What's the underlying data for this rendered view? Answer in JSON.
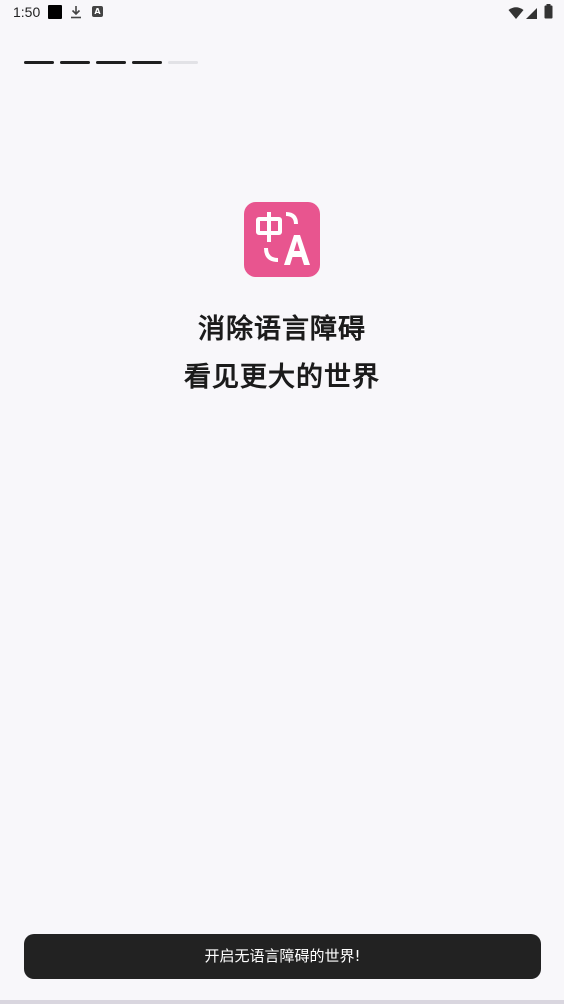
{
  "status_bar": {
    "time": "1:50",
    "notification_icons": [
      "square-icon",
      "download-icon",
      "translate-a-icon"
    ],
    "system_icons": [
      "wifi-icon",
      "signal-icon",
      "battery-icon"
    ]
  },
  "onboarding": {
    "progress": {
      "total_steps": 5,
      "completed_steps": 4
    },
    "logo": {
      "name": "translate-logo-icon",
      "color": "#e8558f",
      "glyphs": "中A"
    },
    "headline_line1": "消除语言障碍",
    "headline_line2": "看见更大的世界",
    "start_button_label": "开启无语言障碍的世界!"
  },
  "colors": {
    "background": "#f8f7fa",
    "accent": "#e8558f",
    "button": "#222222",
    "progress_active": "#1f1f1f",
    "progress_inactive": "#e2e2e6"
  }
}
